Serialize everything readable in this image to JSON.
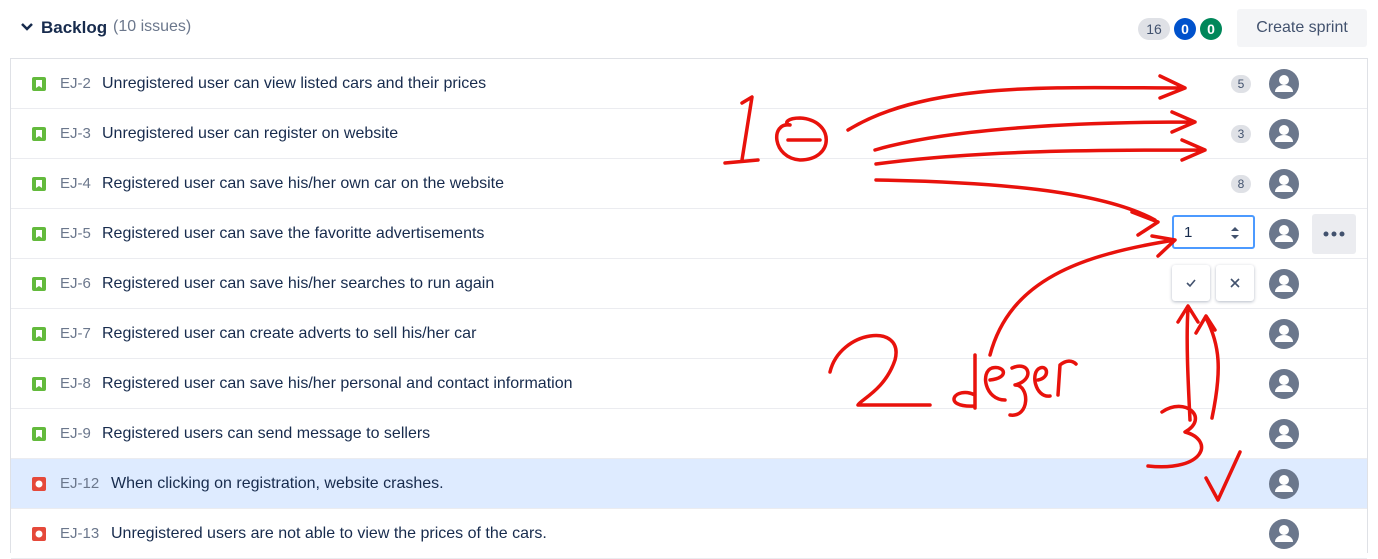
{
  "backlog": {
    "title": "Backlog",
    "count": "(10 issues)",
    "pills": [
      "16",
      "0",
      "0"
    ],
    "create_sprint_label": "Create sprint"
  },
  "issues": [
    {
      "key": "EJ-2",
      "summary": "Unregistered user can view listed cars and their prices",
      "type": "story",
      "estimate": "5"
    },
    {
      "key": "EJ-3",
      "summary": "Unregistered user can register on website",
      "type": "story",
      "estimate": "3"
    },
    {
      "key": "EJ-4",
      "summary": "Registered user can save his/her own car on the website",
      "type": "story",
      "estimate": "8"
    },
    {
      "key": "EJ-5",
      "summary": "Registered user can save the favoritte advertisements",
      "type": "story",
      "estimate_input": "1"
    },
    {
      "key": "EJ-6",
      "summary": "Registered user can save his/her searches to run again",
      "type": "story"
    },
    {
      "key": "EJ-7",
      "summary": "Registered user can create adverts to sell his/her car",
      "type": "story"
    },
    {
      "key": "EJ-8",
      "summary": "Registered user can save his/her personal and contact information",
      "type": "story"
    },
    {
      "key": "EJ-9",
      "summary": "Registered users can send message to sellers",
      "type": "story"
    },
    {
      "key": "EJ-12",
      "summary": "When clicking on registration, website crashes.",
      "type": "bug"
    },
    {
      "key": "EJ-13",
      "summary": "Unregistered users are not able to view the prices of the cars.",
      "type": "bug"
    }
  ],
  "colors": {
    "story": "#63ba3c",
    "bug": "#e5493a",
    "blue_pill": "#0052cc",
    "green_pill": "#00875a",
    "selected_row": "#deebff",
    "annotation": "#e8120c"
  },
  "icons": [
    "chevron-down-icon",
    "story-icon",
    "bug-icon",
    "avatar-icon",
    "more-icon",
    "check-icon",
    "close-icon",
    "spinner-icon"
  ],
  "annotations": {
    "mark1": "1",
    "mark2": "2",
    "word": "değer",
    "mark3": "3"
  }
}
